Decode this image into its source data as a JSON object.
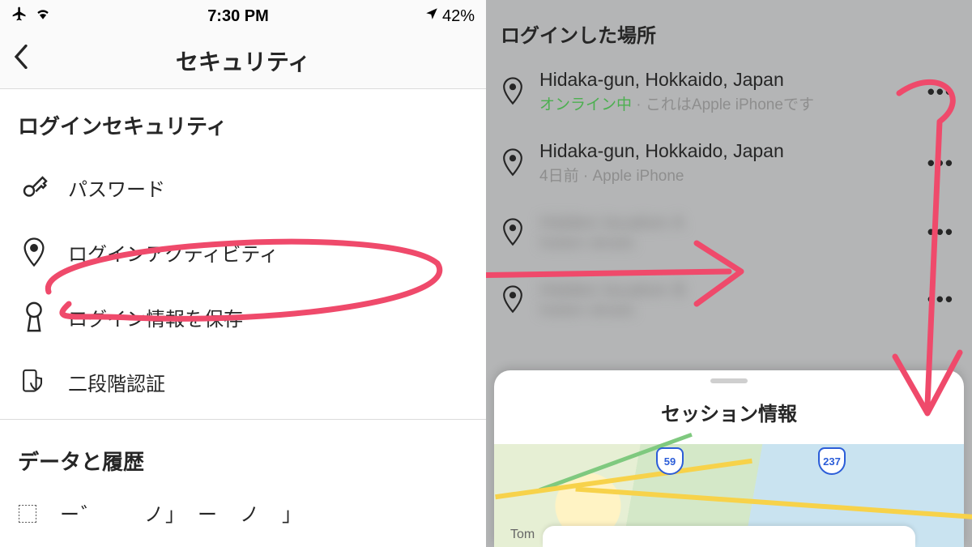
{
  "status": {
    "time": "7:30 PM",
    "battery": "42%"
  },
  "left": {
    "title": "セキュリティ",
    "section1": "ログインセキュリティ",
    "items": {
      "password": "パスワード",
      "activity": "ログインアクティビティ",
      "saveinfo": "ログイン情報を保存",
      "twofactor": "二段階認証"
    },
    "section2": "データと履歴"
  },
  "right": {
    "title": "ログインした場所",
    "sessions": [
      {
        "loc": "Hidaka-gun, Hokkaido, Japan",
        "online": "オンライン中",
        "sep": " · ",
        "device": "これはApple iPhoneです"
      },
      {
        "loc": "Hidaka-gun, Hokkaido, Japan",
        "sub": "4日前 · Apple iPhone"
      },
      {
        "loc": "Hidden location A",
        "sub": "hidden details"
      },
      {
        "loc": "Hidden location B",
        "sub": "hidden details"
      }
    ],
    "sheet_title": "セッション情報",
    "map": {
      "route1": "59",
      "route2": "237",
      "label": "Tom"
    }
  }
}
